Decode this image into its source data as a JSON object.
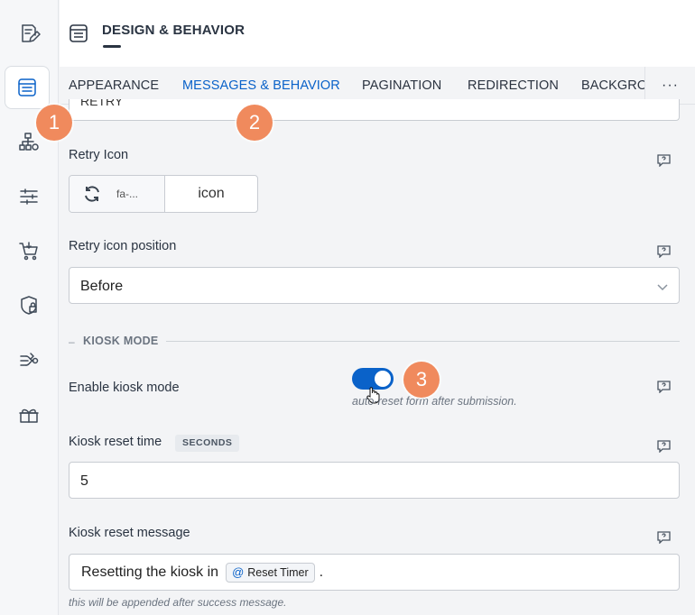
{
  "header": {
    "title": "DESIGN & BEHAVIOR"
  },
  "sidebar": {
    "items": [
      {
        "icon": "edit-form-icon"
      },
      {
        "icon": "form-layout-icon",
        "active": true
      },
      {
        "icon": "hierarchy-settings-icon"
      },
      {
        "icon": "sliders-icon"
      },
      {
        "icon": "cart-icon"
      },
      {
        "icon": "shield-lock-icon"
      },
      {
        "icon": "integrations-icon"
      },
      {
        "icon": "gift-box-icon"
      }
    ]
  },
  "tabs": [
    {
      "label": "APPEARANCE",
      "active": false
    },
    {
      "label": "MESSAGES & BEHAVIOR",
      "active": true
    },
    {
      "label": "PAGINATION",
      "active": false
    },
    {
      "label": "REDIRECTION",
      "active": false
    },
    {
      "label": "BACKGRO",
      "active": false
    }
  ],
  "more_label": "···",
  "fields": {
    "retry_text_value": "RETRY",
    "retry_icon": {
      "label": "Retry Icon",
      "icon_value": "fa-...",
      "type_value": "icon"
    },
    "retry_icon_position": {
      "label": "Retry icon position",
      "value": "Before"
    },
    "kiosk_section": {
      "dash": "–",
      "title": "KIOSK MODE"
    },
    "enable_kiosk": {
      "label": "Enable kiosk mode",
      "enabled": true,
      "hint": "auto-reset form after submission."
    },
    "kiosk_reset_time": {
      "label": "Kiosk reset time",
      "unit_badge": "SECONDS",
      "value": "5"
    },
    "kiosk_reset_message": {
      "label": "Kiosk reset message",
      "prefix": "Resetting the kiosk in",
      "tag_symbol": "@",
      "tag_label": "Reset Timer",
      "suffix": ".",
      "hint": "this will be appended after success message."
    }
  },
  "markers": [
    "1",
    "2",
    "3"
  ],
  "colors": {
    "accent": "#0a62c9",
    "marker": "#f08a5d"
  }
}
